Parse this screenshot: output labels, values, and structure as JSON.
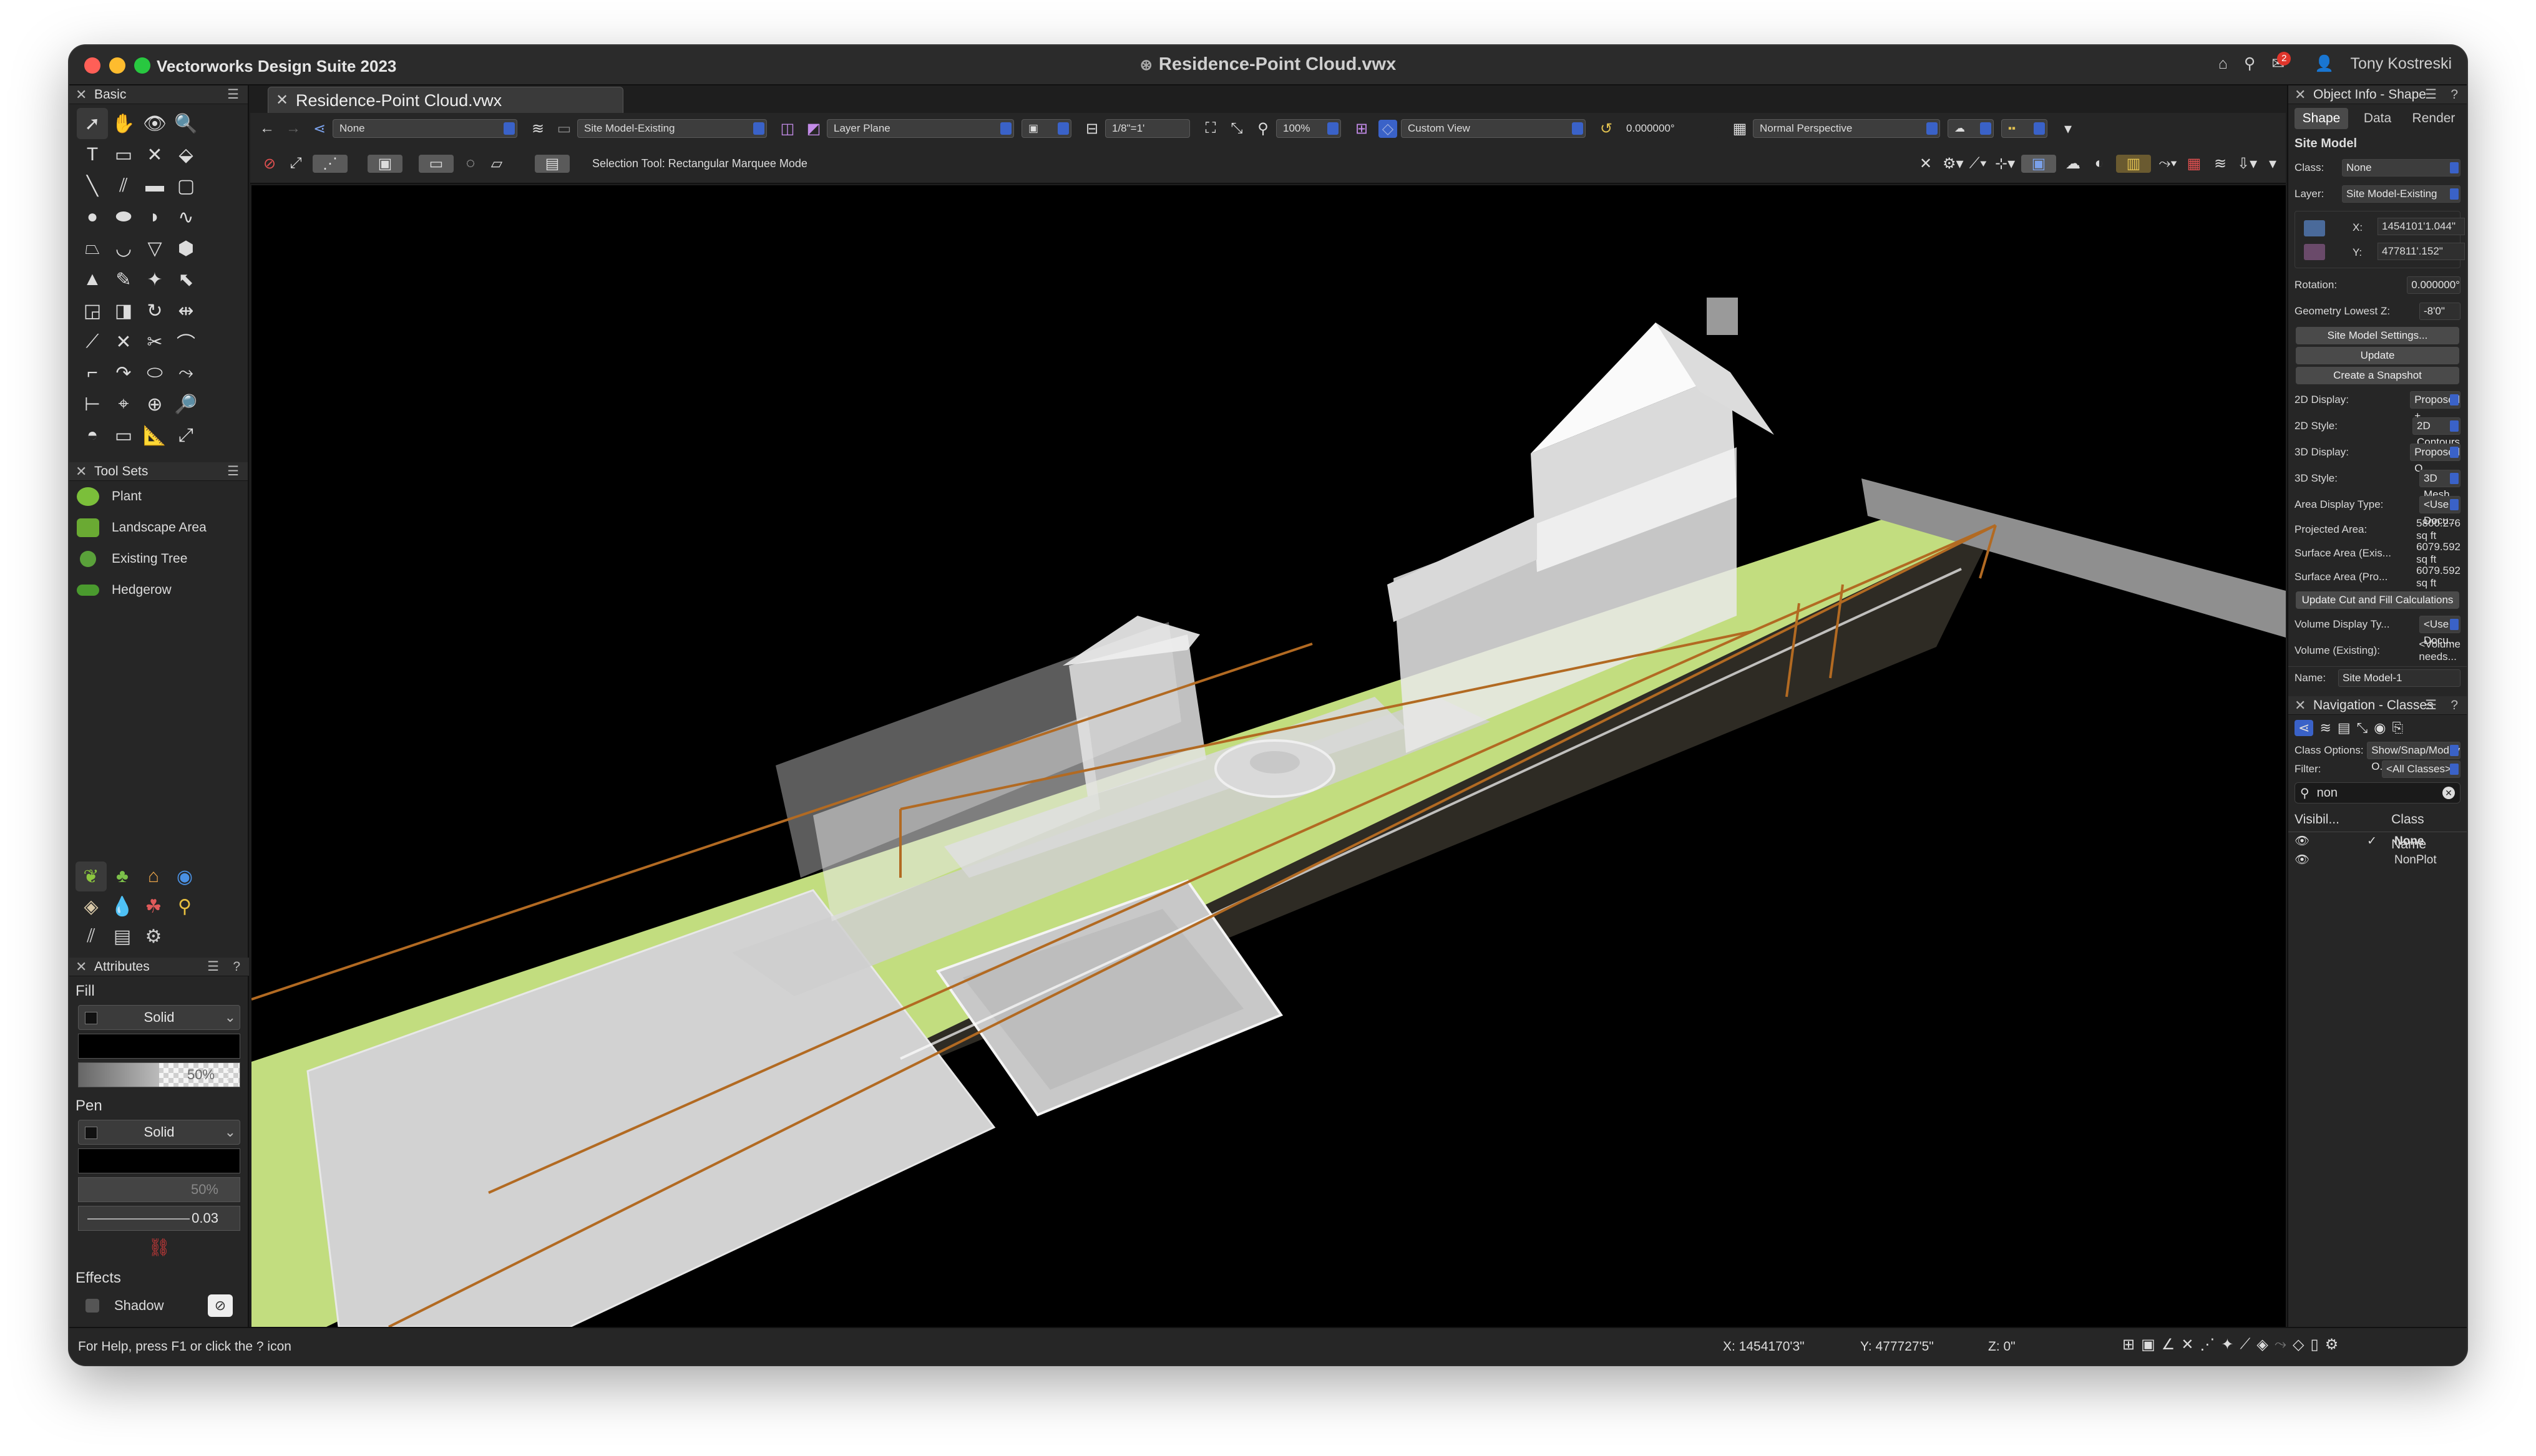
{
  "window": {
    "app_title": "Vectorworks Design Suite 2023",
    "doc_title": "Residence-Point Cloud.vwx",
    "user": "Tony Kostreski",
    "notification_count": "2"
  },
  "doc_tab": {
    "label": "Residence-Point Cloud.vwx"
  },
  "left_palette": {
    "basic_title": "Basic",
    "tool_sets_title": "Tool Sets",
    "tool_sets": [
      {
        "label": "Plant"
      },
      {
        "label": "Landscape Area"
      },
      {
        "label": "Existing Tree"
      },
      {
        "label": "Hedgerow"
      }
    ]
  },
  "attributes": {
    "title": "Attributes",
    "fill_label": "Fill",
    "fill_style": "Solid",
    "fill_opacity": "50%",
    "pen_label": "Pen",
    "pen_style": "Solid",
    "pen_opacity": "50%",
    "pen_thickness": "0.03",
    "effects_label": "Effects",
    "shadow_label": "Shadow"
  },
  "view_bar": {
    "class_select": "None",
    "layer_select": "Site Model-Existing",
    "plane_select": "Layer Plane",
    "scale": "1/8\"=1'",
    "zoom": "100%",
    "view_select": "Custom View",
    "rotation": "0.000000°",
    "projection_select": "Normal Perspective",
    "mode_hint": "Selection Tool: Rectangular Marquee Mode"
  },
  "object_info": {
    "title": "Object Info - Shape",
    "tabs": [
      "Shape",
      "Data",
      "Render"
    ],
    "object_type": "Site Model",
    "class_label": "Class:",
    "class_value": "None",
    "layer_label": "Layer:",
    "layer_value": "Site Model-Existing",
    "x_label": "X:",
    "x_value": "1454101'1.044\"",
    "y_label": "Y:",
    "y_value": "477811'.152\"",
    "rotation_label": "Rotation:",
    "rotation_value": "0.000000°",
    "lowest_z_label": "Geometry Lowest Z:",
    "lowest_z_value": "-8'0\"",
    "btn_settings": "Site Model Settings...",
    "btn_update": "Update",
    "btn_snapshot": "Create a Snapshot",
    "d2_display_label": "2D Display:",
    "d2_display_value": "Proposed +...",
    "d2_style_label": "2D Style:",
    "d2_style_value": "2D Contours",
    "d3_display_label": "3D Display:",
    "d3_display_value": "Proposed O...",
    "d3_style_label": "3D Style:",
    "d3_style_value": "3D Mesh",
    "area_type_label": "Area Display Type:",
    "area_type_value": "<Use Docu...",
    "proj_area_label": "Projected Area:",
    "proj_area_value": "5800.276  sq ft",
    "surf_exist_label": "Surface Area (Exis...",
    "surf_exist_value": "6079.592  sq ft",
    "surf_prop_label": "Surface Area (Pro...",
    "surf_prop_value": "6079.592  sq ft",
    "btn_cutfill": "Update Cut and Fill Calculations",
    "vol_type_label": "Volume Display Ty...",
    "vol_type_value": "<Use Docu...",
    "vol_exist_label": "Volume (Existing):",
    "vol_exist_value": "<Volume needs...",
    "name_label": "Name:",
    "name_value": "Site Model-1"
  },
  "navigation": {
    "title": "Navigation - Classes",
    "class_options_label": "Class Options:",
    "class_options_value": "Show/Snap/Modify O...",
    "filter_label": "Filter:",
    "filter_value": "<All Classes>",
    "search_value": "non",
    "col_visibility": "Visibil...",
    "col_class_name": "Class Name",
    "rows": [
      {
        "name": "None",
        "checked": "✓"
      },
      {
        "name": "NonPlot",
        "checked": ""
      }
    ]
  },
  "status_bar": {
    "help_text": "For Help, press F1 or click the ? icon",
    "x_coord": "X: 1454170'3\"",
    "y_coord": "Y: 477727'5\"",
    "z_coord": "Z: 0\""
  },
  "colors": {
    "accent_blue": "#3a62c8",
    "lawn_green": "#c2dd7f",
    "outline_orange": "#b26a22",
    "close_red": "#ff5f57",
    "minimize_yellow": "#febc2e",
    "zoom_green": "#28c840"
  }
}
